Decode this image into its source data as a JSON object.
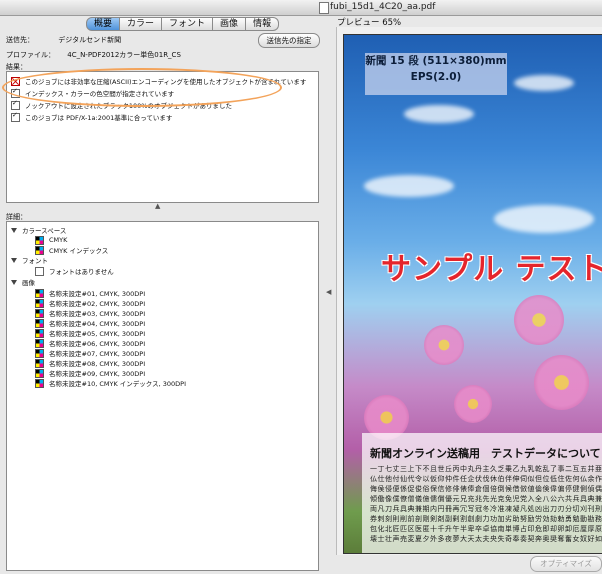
{
  "window": {
    "title": "fubi_15d1_4C20_aa.pdf"
  },
  "tabs": [
    {
      "label": "概要",
      "active": true
    },
    {
      "label": "カラー",
      "active": false
    },
    {
      "label": "フォント",
      "active": false
    },
    {
      "label": "画像",
      "active": false
    },
    {
      "label": "情報",
      "active": false
    }
  ],
  "summary": {
    "destination_label": "送信先：",
    "destination_value": "デジタルセンド新聞",
    "send_button": "送信先の指定",
    "profile_label": "プロファイル：",
    "profile_value": "4C_N-PDF2012カラー単色01R_CS"
  },
  "results": {
    "label": "結果：",
    "items": [
      {
        "status": "error",
        "text": "このジョブには非効率な圧縮(ASCII)エンコーディングを使用したオブジェクトが含まれています"
      },
      {
        "status": "ok",
        "text": "インデックス・カラーの色空間が指定されています"
      },
      {
        "status": "ok",
        "text": "ノックアウトに設定されたブラック100%のオブジェクトがありました"
      },
      {
        "status": "ok",
        "text": "このジョブは PDF/X-1a:2001基準に合っています"
      }
    ]
  },
  "details": {
    "label": "詳細：",
    "groups": [
      {
        "title": "カラースペース",
        "items": [
          "CMYK",
          "CMYK インデックス"
        ]
      },
      {
        "title": "フォント",
        "items": [
          "フォントはありません"
        ]
      },
      {
        "title": "画像",
        "items": [
          "名称未設定#01, CMYK, 300DPI",
          "名称未設定#02, CMYK, 300DPI",
          "名称未設定#03, CMYK, 300DPI",
          "名称未設定#04, CMYK, 300DPI",
          "名称未設定#05, CMYK, 300DPI",
          "名称未設定#06, CMYK, 300DPI",
          "名称未設定#07, CMYK, 300DPI",
          "名称未設定#08, CMYK, 300DPI",
          "名称未設定#09, CMYK, 300DPI",
          "名称未設定#10, CMYK インデックス, 300DPI"
        ]
      }
    ]
  },
  "preview": {
    "label": "プレビュー 65%",
    "ad_size": "新聞 15 段 (511×380)mm",
    "ad_format": "EPS(2.0)",
    "sample_text": "サンプル テスト",
    "box_title": "新聞オンライン送稿用　テストデータについて",
    "box_lines": [
      "一丁七丈三上下不且世丘丙中丸丹主久乏乗乙九乳乾乱了事二互五井亜亡交享京人仁今介",
      "仏仕他付仙代令以仮仰仲件任企伏伐休伯伴伸伺似但位低住佐何仏余作佳併使例侍供依価",
      "侮侯侵便係促俊俗保信修俳俵俸倉個倍倒候借倣値倫倹偉偏停健側偵偶偽傍傑傘備催債傷",
      "傾働像僕僚僧儀億儒償優元兄充兆先光克免児党入全八公六共兵具典兼内円冊再冗写冠冬",
      "両凡刀兵具典兼期内円冊再冗写冠冬冷准凍凝凡処凶出刀刃分切刈刊刑列初判別利到制刷",
      "券刺刻則削前剖剛剣剤副剰割創劇力功加劣助努励労効劾勅勇勉動勘務勝募勢勤勧勲勺匁",
      "包化北匠匹区医匿十千升午半卑卒卓協南単博占印危即却卵卸厄厘厚原厳去参又及友双反",
      "壊士壮声売変夏夕外多夜夢大天太夫央失奇奉奏契奔奥奨奪奮女奴好如妃妊妙妥妨妹妻姉"
    ],
    "optimize_button": "オプティマイズ"
  }
}
